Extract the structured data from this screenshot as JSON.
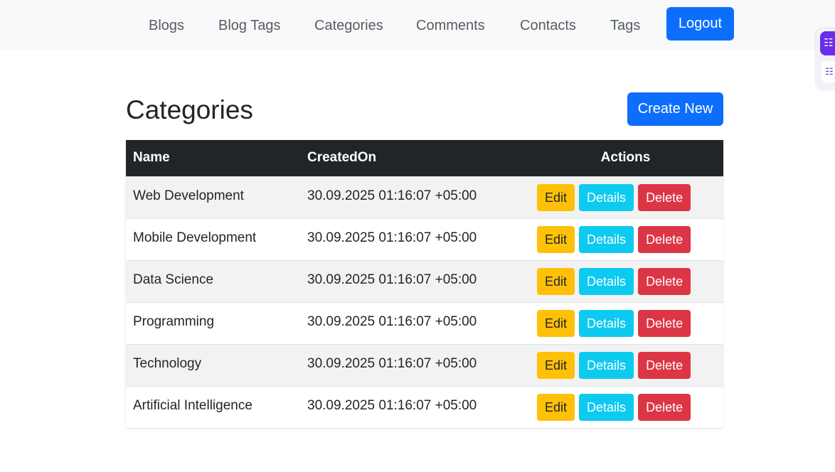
{
  "nav": {
    "links": [
      "Blogs",
      "Blog Tags",
      "Categories",
      "Comments",
      "Contacts",
      "Tags"
    ],
    "logout_label": "Logout"
  },
  "extension": {
    "icon1": "translate-icon",
    "icon2": "translate-ai-icon"
  },
  "page": {
    "title": "Categories",
    "create_label": "Create New"
  },
  "table": {
    "headers": {
      "name": "Name",
      "created": "CreatedOn",
      "actions": "Actions"
    },
    "rows": [
      {
        "name": "Web Development",
        "created": "30.09.2025 01:16:07 +05:00"
      },
      {
        "name": "Mobile Development",
        "created": "30.09.2025 01:16:07 +05:00"
      },
      {
        "name": "Data Science",
        "created": "30.09.2025 01:16:07 +05:00"
      },
      {
        "name": "Programming",
        "created": "30.09.2025 01:16:07 +05:00"
      },
      {
        "name": "Technology",
        "created": "30.09.2025 01:16:07 +05:00"
      },
      {
        "name": "Artificial Intelligence",
        "created": "30.09.2025 01:16:07 +05:00"
      }
    ],
    "actions": {
      "edit": "Edit",
      "details": "Details",
      "delete": "Delete"
    }
  },
  "colors": {
    "primary": "#0d6efd",
    "warning": "#ffc107",
    "info": "#0dcaf0",
    "danger": "#dc3545",
    "dark": "#212529"
  }
}
